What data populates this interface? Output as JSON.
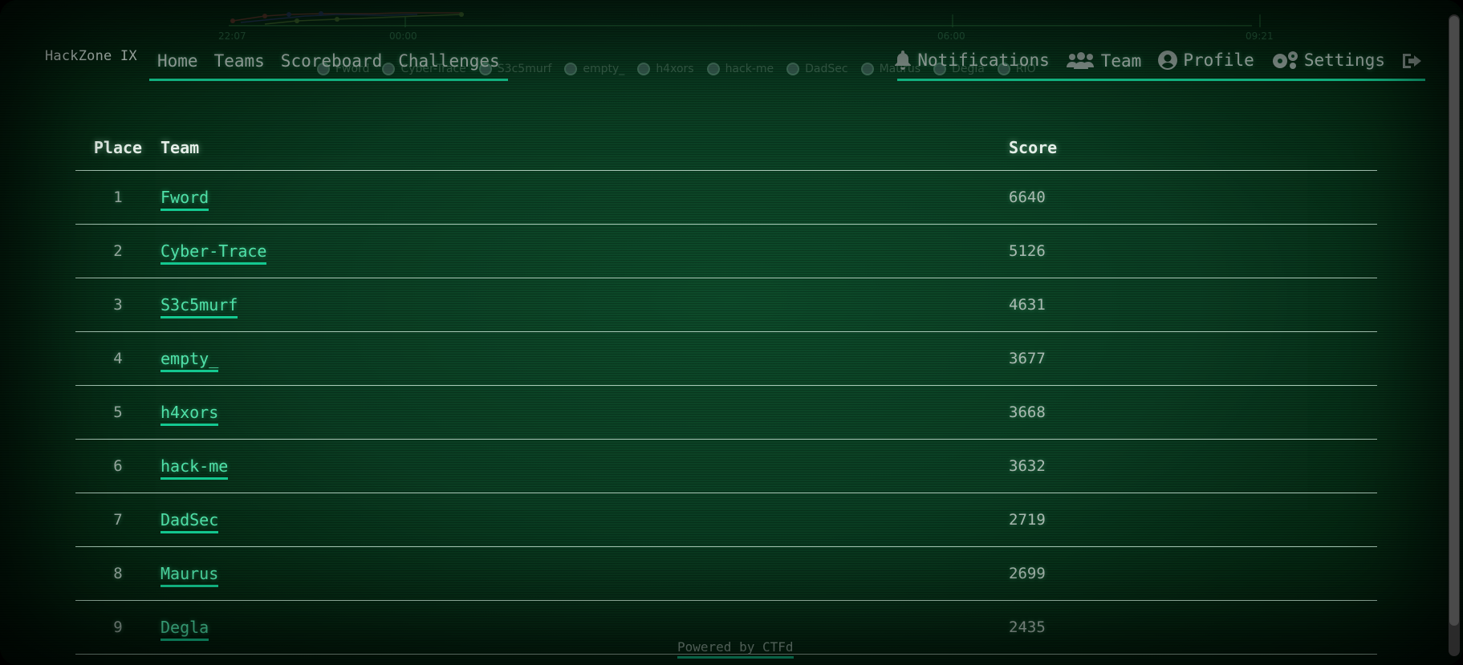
{
  "brand": "HackZone IX",
  "nav": {
    "left": [
      "Home",
      "Teams",
      "Scoreboard",
      "Challenges"
    ],
    "right": [
      {
        "label": "Notifications",
        "icon": "bell-icon"
      },
      {
        "label": "Team",
        "icon": "users-icon"
      },
      {
        "label": "Profile",
        "icon": "user-circle-icon"
      },
      {
        "label": "Settings",
        "icon": "gears-icon"
      },
      {
        "label": "",
        "icon": "logout-icon"
      }
    ]
  },
  "chart_ghost": {
    "ticks": [
      "22:07",
      "00:00",
      "06:00",
      "09:21"
    ],
    "legend": [
      "Fword",
      "Cyber-Trace",
      "S3c5murf",
      "empty_",
      "h4xors",
      "hack-me",
      "DadSec",
      "Maurus",
      "Degla",
      "RIO"
    ]
  },
  "scoreboard": {
    "headers": {
      "place": "Place",
      "team": "Team",
      "score": "Score"
    },
    "rows": [
      {
        "place": "1",
        "team": "Fword",
        "score": "6640"
      },
      {
        "place": "2",
        "team": "Cyber-Trace",
        "score": "5126"
      },
      {
        "place": "3",
        "team": "S3c5murf",
        "score": "4631"
      },
      {
        "place": "4",
        "team": "empty_",
        "score": "3677"
      },
      {
        "place": "5",
        "team": "h4xors",
        "score": "3668"
      },
      {
        "place": "6",
        "team": "hack-me",
        "score": "3632"
      },
      {
        "place": "7",
        "team": "DadSec",
        "score": "2719"
      },
      {
        "place": "8",
        "team": "Maurus",
        "score": "2699"
      },
      {
        "place": "9",
        "team": "Degla",
        "score": "2435"
      }
    ]
  },
  "footer": "Powered by CTFd",
  "colors": {
    "accent": "#14c890",
    "link": "#4fe0a8",
    "background": "#0a3d22"
  }
}
